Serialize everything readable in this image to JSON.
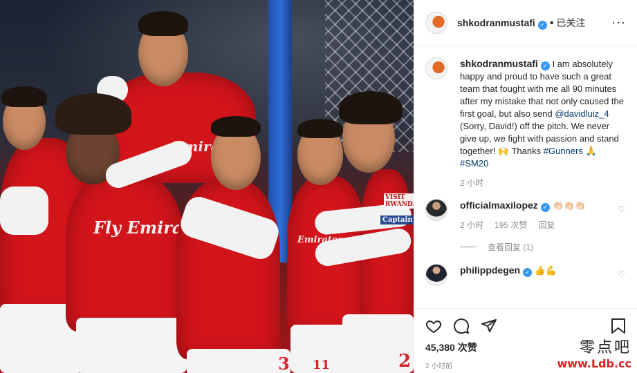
{
  "colors": {
    "link": "#00376b",
    "verified": "#3897f0",
    "muted": "#8e8e8e",
    "jersey": "#d2141b"
  },
  "photo": {
    "sponsor_left": "Emirates",
    "sponsor_center": "Fly Emirates",
    "sponsor_right": "Emirates",
    "sleeve_badge": "VISIT RWANDA",
    "armband": "Captain",
    "num_right": "2",
    "num_center": "3",
    "num_small": "11"
  },
  "header": {
    "username": "shkodranmustafi",
    "dot": "•",
    "follow_status": "已关注",
    "more": "···"
  },
  "caption": {
    "username": "shkodranmustafi",
    "text_1": "I am absolutely happy and proud to have such a great team that fought with me all 90 minutes after my mistake that not only caused the first goal, but also send",
    "mention": "@davidluiz_4",
    "text_2": "(Sorry, David!) off the pitch. We never give up, we fight with passion and stand together! 🙌 Thanks",
    "tag_1": "#Gunners",
    "emoji": "🙏",
    "tag_2": "#SM20",
    "time": "2 小时"
  },
  "comments": [
    {
      "username": "officialmaxilopez",
      "text": "👏🏻👏🏻👏🏻",
      "time": "2 小时",
      "likes": "195 次赞",
      "reply": "回复",
      "view_replies": "查看回复 (1)"
    },
    {
      "username": "philippdegen",
      "text": "👍💪"
    }
  ],
  "actions": {
    "icons": [
      "heart-icon",
      "comment-icon",
      "share-icon",
      "bookmark-icon"
    ],
    "likes": "45,380 次赞",
    "time": "2 小时前"
  },
  "watermark": {
    "line1": "零点吧",
    "line2": "www.Ldb.cc"
  }
}
